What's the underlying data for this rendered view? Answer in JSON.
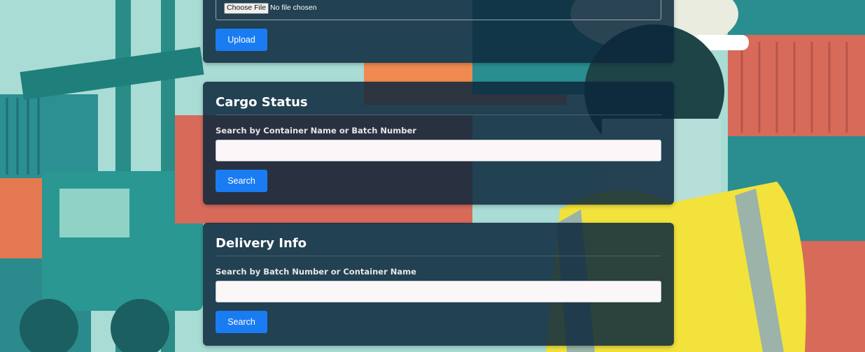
{
  "upload_section": {
    "choose_file_label": "Choose File",
    "file_status": "No file chosen",
    "upload_button": "Upload"
  },
  "cargo_status": {
    "title": "Cargo Status",
    "search_label": "Search by Container Name or Batch Number",
    "search_value": "",
    "search_button": "Search"
  },
  "delivery_info": {
    "title": "Delivery Info",
    "search_label": "Search by Batch Number or Container Name",
    "search_value": "",
    "search_button": "Search"
  },
  "colors": {
    "button_blue": "#1a7cf2",
    "card_bg": "#0c283c"
  }
}
